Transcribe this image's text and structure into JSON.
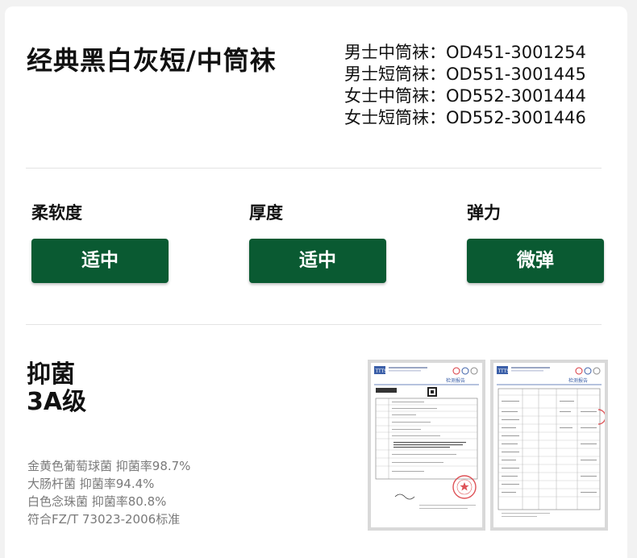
{
  "product": {
    "title": "经典黑白灰短/中筒袜",
    "codes": [
      "男士中筒袜：OD451-3001254",
      "男士短筒袜：OD551-3001445",
      "女士中筒袜：OD552-3001444",
      "女士短筒袜：OD552-3001446"
    ]
  },
  "attributes": [
    {
      "label": "柔软度",
      "value": "适中"
    },
    {
      "label": "厚度",
      "value": "适中"
    },
    {
      "label": "弹力",
      "value": "微弹"
    }
  ],
  "antibacterial": {
    "title_line1": "抑菌",
    "title_line2": "3A级",
    "facts": [
      "金黄色葡萄球菌 抑菌率98.7%",
      "大肠杆菌 抑菌率94.4%",
      "白色念珠菌 抑菌率80.8%",
      "符合FZ/T 73023-2006标准"
    ]
  },
  "colors": {
    "accent_green": "#0a5a32",
    "stamp_red": "#d8343a"
  },
  "reports": [
    {
      "logo": "TTTS",
      "heading": "检测报告"
    },
    {
      "logo": "TTTS",
      "heading": "检测报告"
    }
  ]
}
